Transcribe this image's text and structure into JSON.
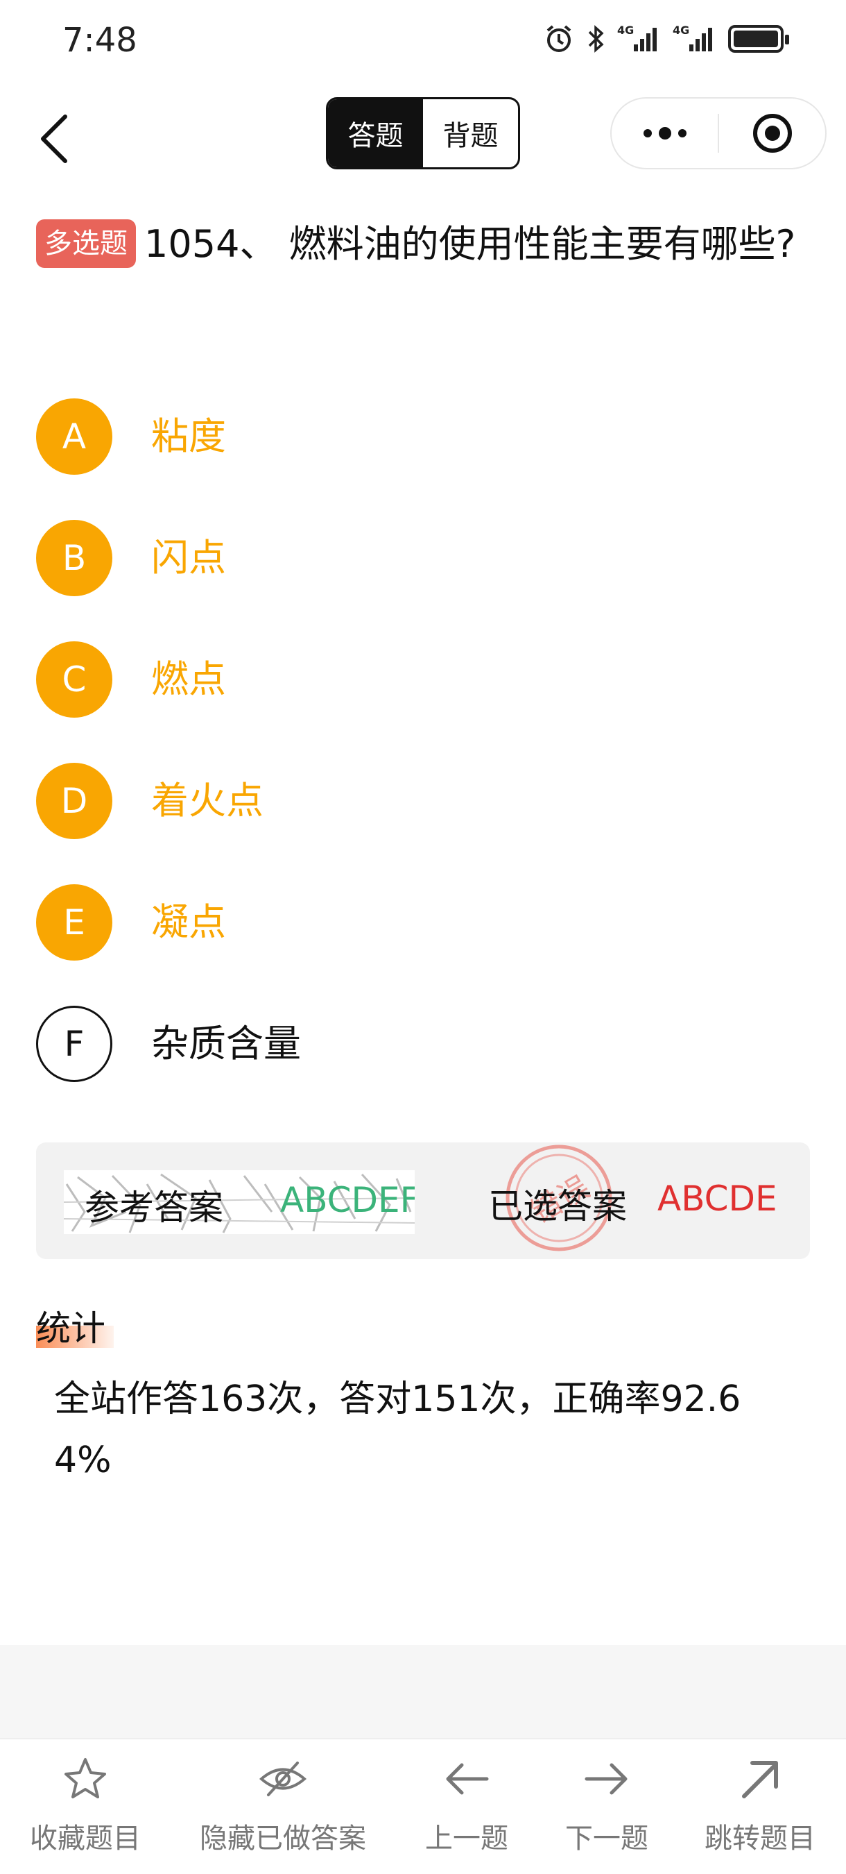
{
  "status_bar": {
    "time": "7:48",
    "network_1": "4G",
    "network_2": "4G"
  },
  "header": {
    "modes": [
      {
        "label": "答题",
        "active": true
      },
      {
        "label": "背题",
        "active": false
      }
    ]
  },
  "question": {
    "type": "多选题",
    "text": "1054、 燃料油的使用性能主要有哪些?"
  },
  "options": [
    {
      "letter": "A",
      "text": "粘度",
      "selected": true
    },
    {
      "letter": "B",
      "text": "闪点",
      "selected": true
    },
    {
      "letter": "C",
      "text": "燃点",
      "selected": true
    },
    {
      "letter": "D",
      "text": "着火点",
      "selected": true
    },
    {
      "letter": "E",
      "text": "凝点",
      "selected": true
    },
    {
      "letter": "F",
      "text": "杂质含量",
      "selected": false
    }
  ],
  "answer": {
    "reference_label": "参考答案",
    "reference_value": "ABCDEF",
    "selected_label": "已选答案",
    "selected_value": "ABCDE",
    "stamp_text": "错误",
    "colors": {
      "correct": "#3bb37a",
      "wrong": "#e03030"
    }
  },
  "stats": {
    "title": "统计",
    "text": "全站作答163次，答对151次，正确率92.64%"
  },
  "bottom_bar": [
    {
      "label": "收藏题目",
      "icon": "star-icon"
    },
    {
      "label": "隐藏已做答案",
      "icon": "eye-off-icon"
    },
    {
      "label": "上一题",
      "icon": "arrow-left-icon"
    },
    {
      "label": "下一题",
      "icon": "arrow-right-icon"
    },
    {
      "label": "跳转题目",
      "icon": "arrow-up-right-icon"
    }
  ],
  "accent_colors": {
    "option_selected": "#f9a602",
    "question_type_badge": "#e8645a"
  }
}
